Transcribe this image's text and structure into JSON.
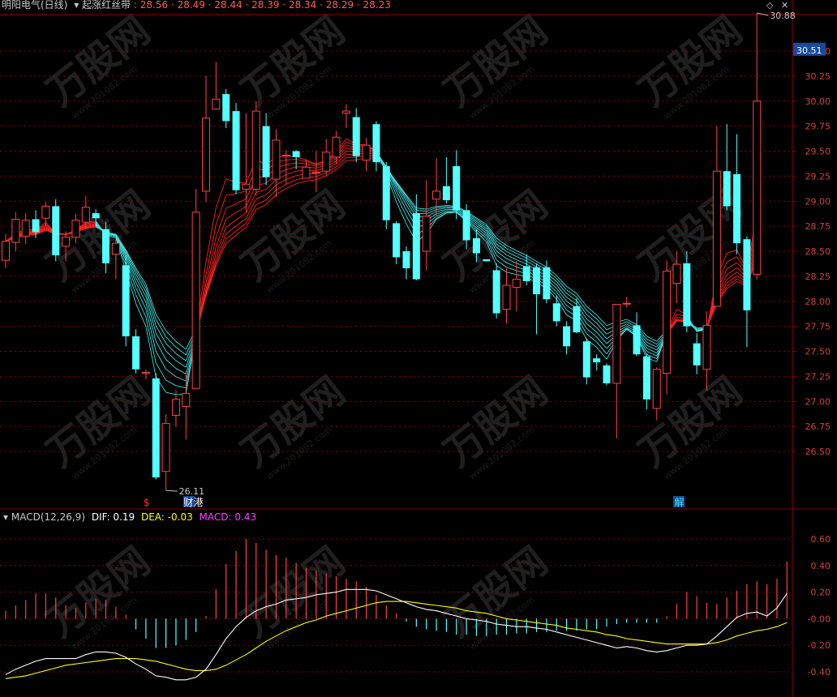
{
  "header": {
    "stock": "明阳电气(日线)",
    "indicator": "起涨红丝带",
    "values": [
      "28.56",
      "28.49",
      "28.44",
      "28.39",
      "28.34",
      "28.29",
      "28.23"
    ],
    "value_color": "#ff5a5a"
  },
  "macd_header": {
    "name": "MACD(12,26,9)",
    "dif": "DIF: 0.19",
    "dea": "DEA: -0.03",
    "macd": "MACD: 0.43"
  },
  "current_price": "30.51",
  "watermark": {
    "brand": "万股网",
    "url": "www.201082.com"
  },
  "colors": {
    "up": "#ff4040",
    "down": "#54ffff",
    "grid": "#8c0000",
    "axis_text": "#d04040",
    "dif": "#ffffff",
    "dea": "#ffff00",
    "ribbon_up": "#ff2020",
    "ribbon_down": "#40e0e0"
  },
  "chart_data": [
    {
      "type": "candlestick",
      "title": "明阳电气(日线)",
      "y_ticks": [
        "30.50",
        "30.25",
        "30.00",
        "29.75",
        "29.50",
        "29.25",
        "29.00",
        "28.75",
        "28.50",
        "28.25",
        "28.00",
        "27.75",
        "27.50",
        "27.25",
        "27.00",
        "26.75",
        "26.50"
      ],
      "ylim": [
        26.25,
        30.6
      ],
      "annotations": {
        "high": "30.88",
        "low": "26.11",
        "event_labels": [
          "$",
          "财",
          "港",
          "解"
        ]
      },
      "candles": [
        [
          28.41,
          28.6,
          28.67,
          28.33
        ],
        [
          28.59,
          28.82,
          28.89,
          28.5
        ],
        [
          28.65,
          28.81,
          28.88,
          28.57
        ],
        [
          28.82,
          28.69,
          28.91,
          28.63
        ],
        [
          28.83,
          28.95,
          28.99,
          28.75
        ],
        [
          28.95,
          28.46,
          29.02,
          28.4
        ],
        [
          28.55,
          28.64,
          28.7,
          28.4
        ],
        [
          28.64,
          28.81,
          28.87,
          28.58
        ],
        [
          28.79,
          28.94,
          29.05,
          28.72
        ],
        [
          28.88,
          28.83,
          28.92,
          28.75
        ],
        [
          28.72,
          28.38,
          28.79,
          28.28
        ],
        [
          28.47,
          28.58,
          28.62,
          28.22
        ],
        [
          28.36,
          27.65,
          28.46,
          27.55
        ],
        [
          27.65,
          27.32,
          27.72,
          27.28
        ],
        [
          27.28,
          27.29,
          27.32,
          27.22
        ],
        [
          27.23,
          26.24,
          27.28,
          26.22
        ],
        [
          26.3,
          26.78,
          26.87,
          26.11
        ],
        [
          26.86,
          27.02,
          27.11,
          26.75
        ],
        [
          26.95,
          27.08,
          27.3,
          26.62
        ],
        [
          27.13,
          28.89,
          29.12,
          27.13
        ],
        [
          29.1,
          29.83,
          30.25,
          28.99
        ],
        [
          29.92,
          30.02,
          30.39,
          29.93
        ],
        [
          30.07,
          29.8,
          30.12,
          29.73
        ],
        [
          29.9,
          29.11,
          29.98,
          29.07
        ],
        [
          29.12,
          29.17,
          29.88,
          28.89
        ],
        [
          29.12,
          29.9,
          30.0,
          29.06
        ],
        [
          29.75,
          29.24,
          29.88,
          29.16
        ],
        [
          29.22,
          29.61,
          29.72,
          29.04
        ],
        [
          29.45,
          29.46,
          29.51,
          29.17
        ],
        [
          29.5,
          29.44,
          29.51,
          29.32
        ],
        [
          29.23,
          29.34,
          29.42,
          29.23
        ],
        [
          29.28,
          29.29,
          29.5,
          29.09
        ],
        [
          29.3,
          29.49,
          29.62,
          29.26
        ],
        [
          29.44,
          29.64,
          29.7,
          29.37
        ],
        [
          29.88,
          29.9,
          29.97,
          29.73
        ],
        [
          29.84,
          29.45,
          29.93,
          29.39
        ],
        [
          29.41,
          29.56,
          29.63,
          29.3
        ],
        [
          29.77,
          29.39,
          29.8,
          29.3
        ],
        [
          29.35,
          28.81,
          29.39,
          28.72
        ],
        [
          28.78,
          28.44,
          28.8,
          28.37
        ],
        [
          28.5,
          28.33,
          28.55,
          28.22
        ],
        [
          28.88,
          28.22,
          29.07,
          28.21
        ],
        [
          28.5,
          28.85,
          29.21,
          28.31
        ],
        [
          29.02,
          29.1,
          29.43,
          28.85
        ],
        [
          29.15,
          29.01,
          29.44,
          28.98
        ],
        [
          29.35,
          28.91,
          29.51,
          28.82
        ],
        [
          28.91,
          28.61,
          28.97,
          28.52
        ],
        [
          28.63,
          28.48,
          28.72,
          28.39
        ],
        [
          28.42,
          28.4,
          28.42,
          28.4
        ],
        [
          28.31,
          27.88,
          28.38,
          27.83
        ],
        [
          27.92,
          28.16,
          28.33,
          27.78
        ],
        [
          28.14,
          28.22,
          28.4,
          27.9
        ],
        [
          28.35,
          28.2,
          28.47,
          28.16
        ],
        [
          28.34,
          28.07,
          28.38,
          27.67
        ],
        [
          28.34,
          28.02,
          28.41,
          27.98
        ],
        [
          27.98,
          27.8,
          28.05,
          27.75
        ],
        [
          27.75,
          27.55,
          27.8,
          27.47
        ],
        [
          27.95,
          27.69,
          28.03,
          27.68
        ],
        [
          27.6,
          27.24,
          27.63,
          27.17
        ],
        [
          27.43,
          27.39,
          27.47,
          27.31
        ],
        [
          27.36,
          27.18,
          27.38,
          27.16
        ],
        [
          27.18,
          27.97,
          27.39,
          26.63
        ],
        [
          27.98,
          27.98,
          28.04,
          27.94
        ],
        [
          27.76,
          27.47,
          27.89,
          27.45
        ],
        [
          27.45,
          27.02,
          27.48,
          26.92
        ],
        [
          26.93,
          27.32,
          27.34,
          26.81
        ],
        [
          27.28,
          28.3,
          28.41,
          27.07
        ],
        [
          28.18,
          28.37,
          28.5,
          27.98
        ],
        [
          28.38,
          27.75,
          28.5,
          27.69
        ],
        [
          27.58,
          27.36,
          27.68,
          27.27
        ],
        [
          27.32,
          27.76,
          27.9,
          27.11
        ],
        [
          27.95,
          29.3,
          29.75,
          27.95
        ],
        [
          29.3,
          28.95,
          29.77,
          28.91
        ],
        [
          29.27,
          28.58,
          29.67,
          28.47
        ],
        [
          28.62,
          27.91,
          28.65,
          27.54
        ],
        [
          28.27,
          30.0,
          30.88,
          28.22
        ]
      ]
    },
    {
      "type": "macd",
      "title": "MACD(12,26,9)",
      "y_ticks": [
        "0.60",
        "0.40",
        "0.20",
        "-0.00",
        "-0.20",
        "-0.40"
      ],
      "ylim": [
        -0.55,
        0.7
      ],
      "dif": [
        -0.42,
        -0.38,
        -0.35,
        -0.32,
        -0.3,
        -0.3,
        -0.3,
        -0.3,
        -0.27,
        -0.25,
        -0.25,
        -0.26,
        -0.29,
        -0.34,
        -0.38,
        -0.43,
        -0.44,
        -0.46,
        -0.46,
        -0.44,
        -0.38,
        -0.27,
        -0.15,
        -0.06,
        0.01,
        0.06,
        0.09,
        0.11,
        0.14,
        0.15,
        0.16,
        0.18,
        0.19,
        0.2,
        0.22,
        0.22,
        0.22,
        0.21,
        0.18,
        0.15,
        0.12,
        0.09,
        0.07,
        0.06,
        0.04,
        0.02,
        0.0,
        -0.01,
        -0.02,
        -0.04,
        -0.05,
        -0.06,
        -0.06,
        -0.07,
        -0.08,
        -0.1,
        -0.12,
        -0.14,
        -0.16,
        -0.18,
        -0.2,
        -0.22,
        -0.21,
        -0.22,
        -0.24,
        -0.25,
        -0.24,
        -0.22,
        -0.2,
        -0.2,
        -0.19,
        -0.13,
        -0.06,
        0.01,
        0.04,
        0.05,
        0.02,
        0.08,
        0.19
      ],
      "dea": [
        -0.45,
        -0.44,
        -0.43,
        -0.41,
        -0.39,
        -0.37,
        -0.35,
        -0.34,
        -0.33,
        -0.32,
        -0.31,
        -0.3,
        -0.3,
        -0.3,
        -0.31,
        -0.32,
        -0.34,
        -0.36,
        -0.38,
        -0.39,
        -0.39,
        -0.38,
        -0.35,
        -0.31,
        -0.27,
        -0.22,
        -0.17,
        -0.13,
        -0.09,
        -0.06,
        -0.03,
        -0.01,
        0.02,
        0.04,
        0.06,
        0.08,
        0.1,
        0.12,
        0.13,
        0.13,
        0.13,
        0.12,
        0.11,
        0.1,
        0.09,
        0.08,
        0.06,
        0.05,
        0.04,
        0.02,
        0.0,
        -0.01,
        -0.02,
        -0.03,
        -0.04,
        -0.05,
        -0.07,
        -0.08,
        -0.09,
        -0.1,
        -0.12,
        -0.13,
        -0.15,
        -0.16,
        -0.17,
        -0.18,
        -0.19,
        -0.19,
        -0.19,
        -0.19,
        -0.19,
        -0.18,
        -0.16,
        -0.13,
        -0.11,
        -0.09,
        -0.08,
        -0.06,
        -0.03
      ],
      "macd": [
        0.06,
        0.1,
        0.14,
        0.19,
        0.19,
        0.16,
        0.1,
        0.08,
        0.12,
        0.15,
        0.14,
        0.09,
        0.03,
        -0.08,
        -0.15,
        -0.22,
        -0.22,
        -0.2,
        -0.16,
        -0.1,
        0.02,
        0.22,
        0.41,
        0.51,
        0.6,
        0.57,
        0.52,
        0.48,
        0.46,
        0.42,
        0.38,
        0.36,
        0.34,
        0.32,
        0.3,
        0.28,
        0.24,
        0.18,
        0.1,
        0.04,
        -0.02,
        -0.06,
        -0.08,
        -0.09,
        -0.1,
        -0.12,
        -0.12,
        -0.13,
        -0.13,
        -0.12,
        -0.12,
        -0.11,
        -0.11,
        -0.1,
        -0.1,
        -0.09,
        -0.09,
        -0.09,
        -0.08,
        -0.08,
        -0.06,
        -0.04,
        -0.03,
        -0.03,
        -0.03,
        -0.03,
        0.02,
        0.11,
        0.2,
        0.17,
        0.12,
        0.11,
        0.16,
        0.21,
        0.26,
        0.28,
        0.26,
        0.3,
        0.43
      ]
    }
  ]
}
